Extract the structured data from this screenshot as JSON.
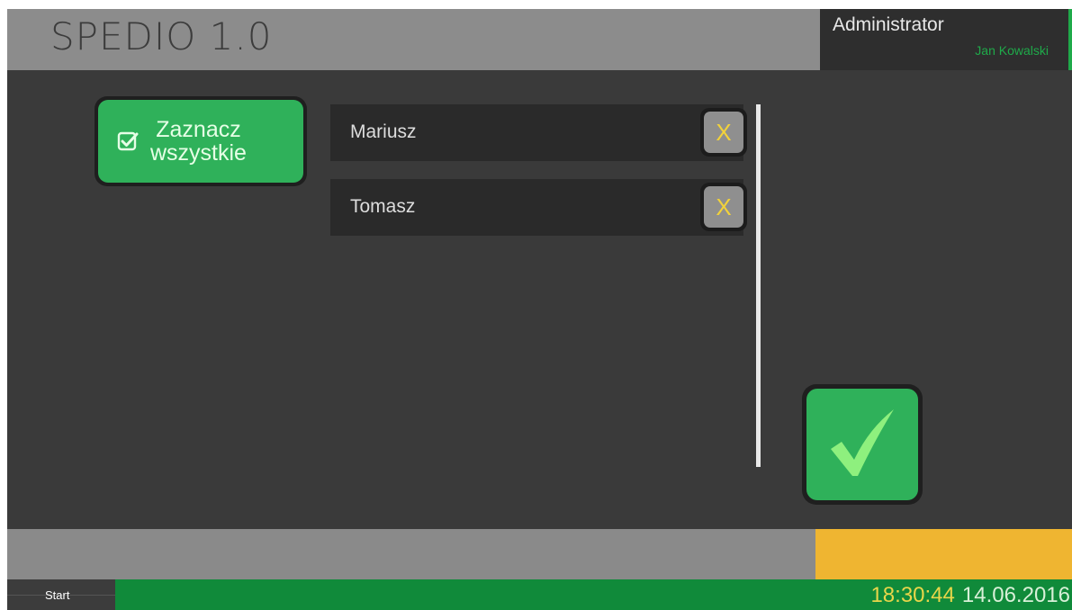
{
  "header": {
    "title": "SPEDIO 1.0",
    "user_role": "Administrator",
    "user_name": "Jan Kowalski"
  },
  "select_all": {
    "label": "Zaznacz\nwszystkie",
    "icon": "checkbox-checked-icon"
  },
  "list": {
    "items": [
      {
        "name": "Mariusz",
        "remove_label": "X"
      },
      {
        "name": "Tomasz",
        "remove_label": "X"
      }
    ]
  },
  "confirm": {
    "icon": "checkmark-icon"
  },
  "taskbar": {
    "start_label": "Start",
    "time": "18:30:44",
    "date": "14.06.2016"
  },
  "colors": {
    "background": "#3a3a3a",
    "header": "#8c8c8c",
    "accent_green": "#2fb15a",
    "taskbar_green": "#108a3a",
    "warning_yellow": "#efb531",
    "remove_x": "#f2d23a"
  }
}
